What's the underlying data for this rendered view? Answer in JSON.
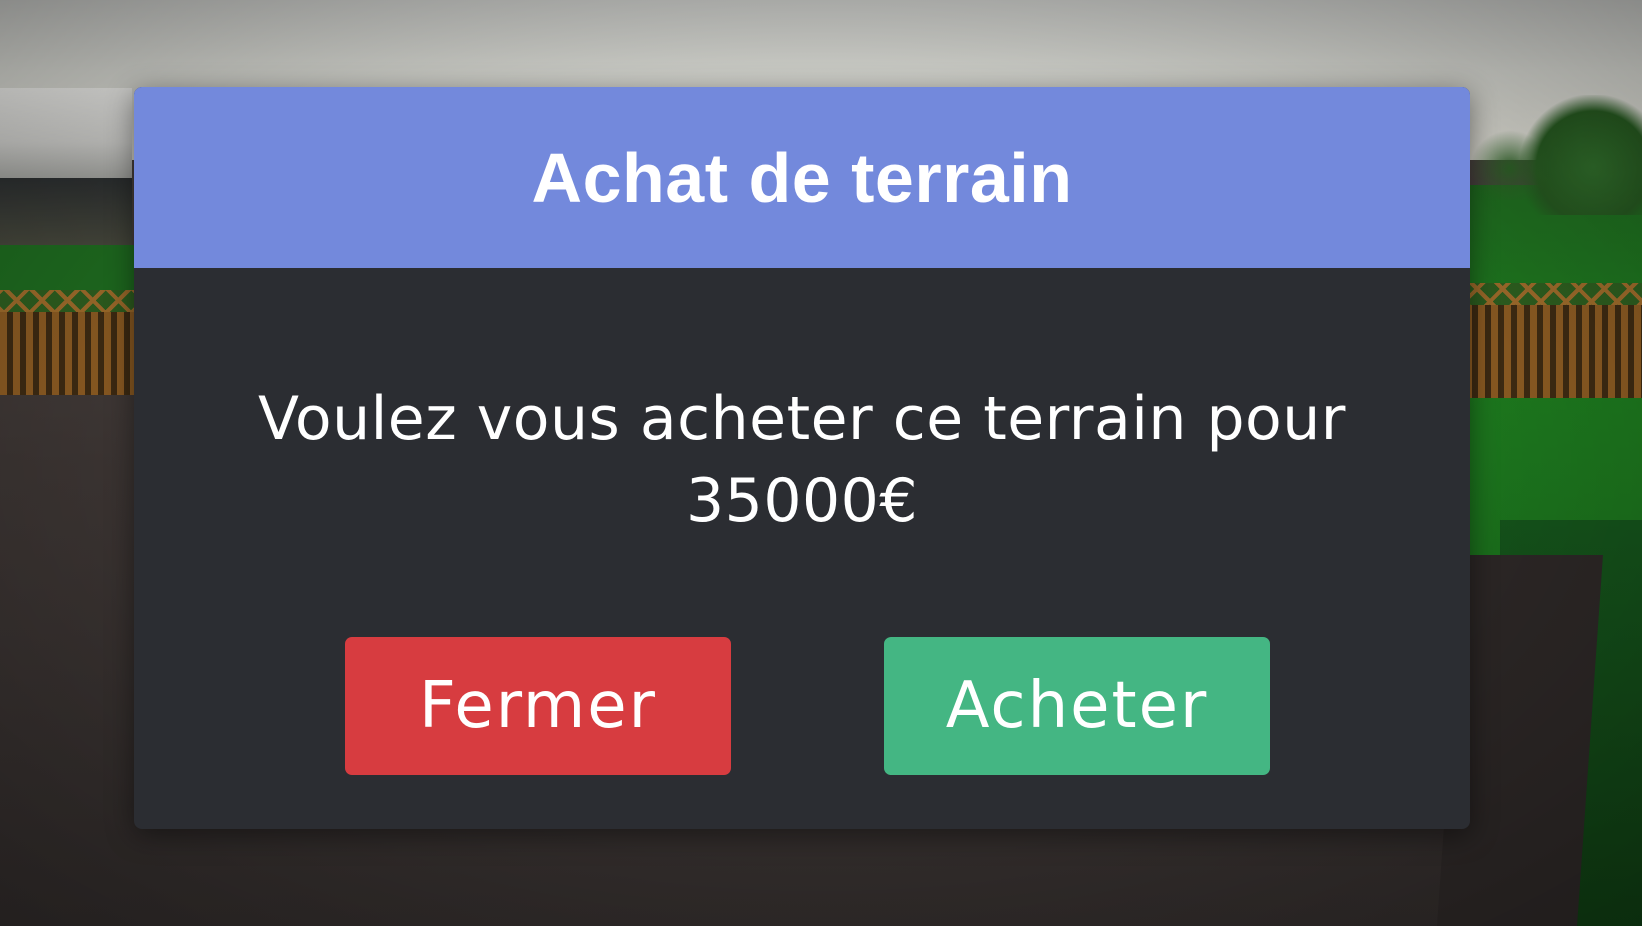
{
  "dialog": {
    "title": "Achat de terrain",
    "message": "Voulez vous acheter ce terrain pour 35000€",
    "buttons": {
      "close_label": "Fermer",
      "buy_label": "Acheter"
    }
  },
  "colors": {
    "header": "#7389dc",
    "body": "#2b2d32",
    "close_button": "#d73c40",
    "buy_button": "#44b683"
  }
}
